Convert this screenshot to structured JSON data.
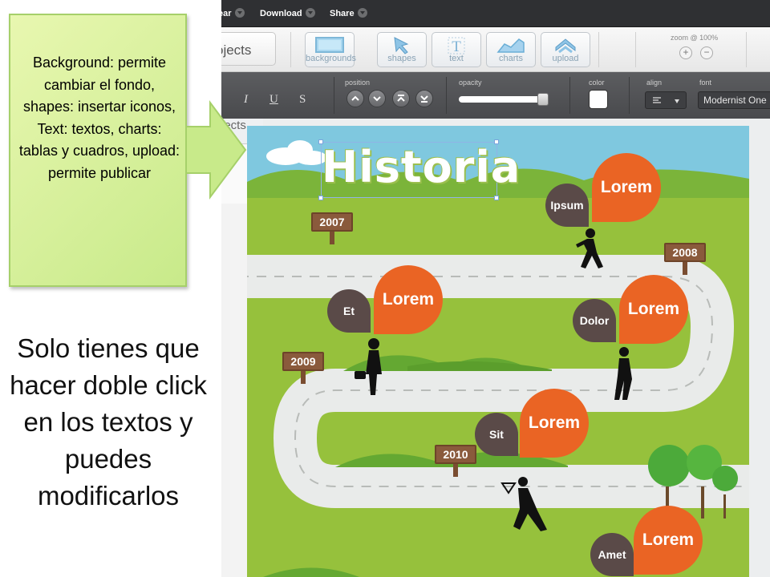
{
  "menubar": {
    "items": [
      {
        "label": "Download"
      },
      {
        "label": "Share"
      }
    ]
  },
  "toolbar": {
    "projects_label": "ojects",
    "tools": [
      {
        "label": "backgrounds",
        "icon": "backgrounds-icon"
      },
      {
        "label": "shapes",
        "icon": "arrow-cursor-icon"
      },
      {
        "label": "text",
        "icon": "text-T-icon"
      },
      {
        "label": "charts",
        "icon": "area-chart-icon"
      },
      {
        "label": "upload",
        "icon": "upload-chevron-icon"
      }
    ],
    "zoom": {
      "label": "zoom @ 100%",
      "zoom_in": "+",
      "zoom_out": "−"
    }
  },
  "formatbar": {
    "style_buttons": {
      "italic": "I",
      "underline": "U",
      "strike": "S"
    },
    "position_label": "position",
    "opacity_label": "opacity",
    "opacity_value": 0.95,
    "color_label": "color",
    "color_value": "#ffffff",
    "align_label": "align",
    "font_label": "font",
    "font_value": "Modernist One"
  },
  "sidebar": {
    "objects_label": "jects"
  },
  "infographic": {
    "title": "Historia",
    "years": [
      "2007",
      "2008",
      "2009",
      "2010"
    ],
    "milestones": [
      {
        "word": "Ipsum",
        "lorem": "Lorem"
      },
      {
        "word": "Et",
        "lorem": "Lorem"
      },
      {
        "word": "Dolor",
        "lorem": "Lorem"
      },
      {
        "word": "Sit",
        "lorem": "Lorem"
      },
      {
        "word": "Amet",
        "lorem": "Lorem"
      }
    ],
    "colors": {
      "sky": "#7fc8df",
      "grass": "#96c13c",
      "hill": "#64a832",
      "road": "#ecedec",
      "bubble_orange": "#ea6424",
      "bubble_dark": "#5a4a48",
      "sign": "#8a5a3c"
    }
  },
  "callout": {
    "text": "Background: permite cambiar el  fondo, shapes: insertar iconos, Text: textos, charts: tablas  y cuadros, upload: permite publicar"
  },
  "instructions": {
    "text": "Solo tienes que hacer doble  click en los textos y puedes modificarlos"
  }
}
